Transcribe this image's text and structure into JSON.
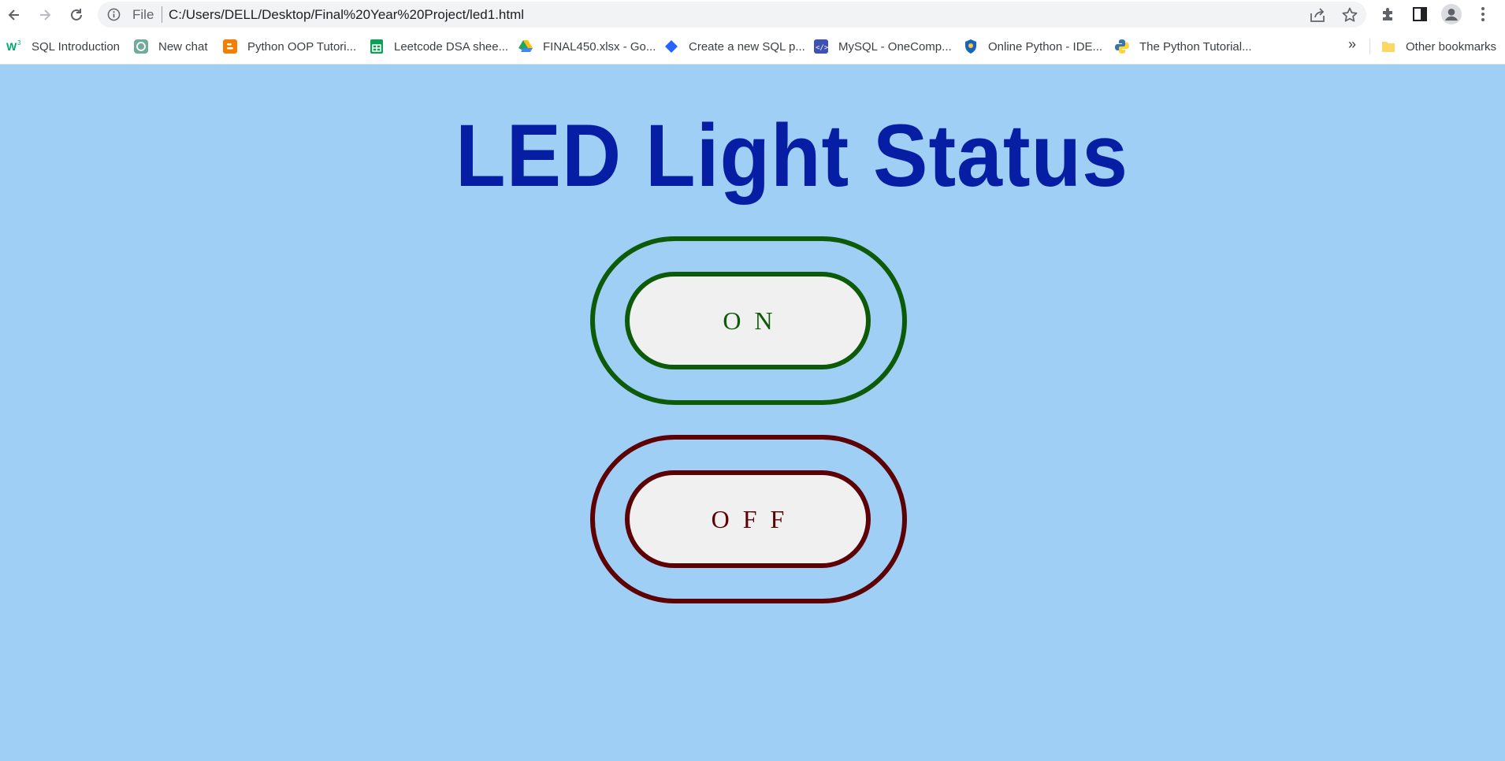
{
  "browser": {
    "omnibox": {
      "scheme_label": "File",
      "url": "C:/Users/DELL/Desktop/Final%20Year%20Project/led1.html"
    },
    "bookmarks": [
      {
        "label": "SQL Introduction",
        "icon": "w3schools-icon"
      },
      {
        "label": "New chat",
        "icon": "chatgpt-icon"
      },
      {
        "label": "Python OOP Tutori...",
        "icon": "blogger-icon"
      },
      {
        "label": "Leetcode DSA shee...",
        "icon": "google-sheets-icon"
      },
      {
        "label": "FINAL450.xlsx - Go...",
        "icon": "google-drive-icon"
      },
      {
        "label": "Create a new SQL p...",
        "icon": "diamond-icon"
      },
      {
        "label": "MySQL - OneComp...",
        "icon": "code-icon"
      },
      {
        "label": "Online Python - IDE...",
        "icon": "shield-icon"
      },
      {
        "label": "The Python Tutorial...",
        "icon": "python-icon"
      }
    ],
    "more_label": "»",
    "other_bookmarks": "Other bookmarks"
  },
  "page": {
    "title": "LED Light Status",
    "on_label": "ON",
    "off_label": "OFF"
  },
  "colors": {
    "background": "#9fcff5",
    "title": "#061ea4",
    "on": "#0d5b08",
    "off": "#5d0105",
    "button_fill": "#f0f0f0"
  }
}
